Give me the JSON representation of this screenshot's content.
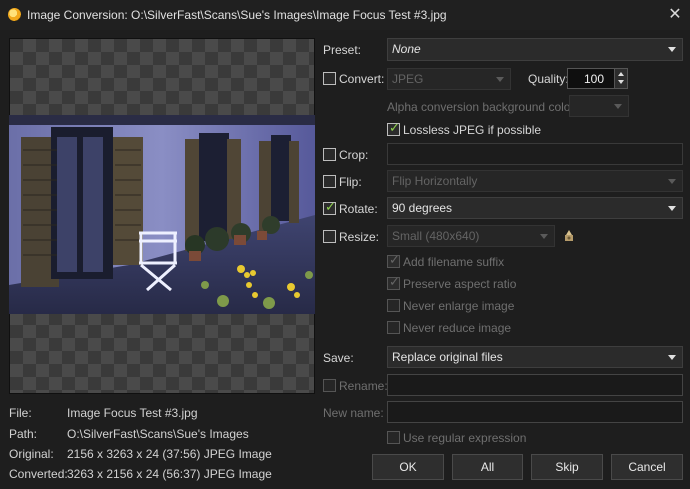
{
  "window": {
    "title": "Image Conversion: O:\\SilverFast\\Scans\\Sue's Images\\Image Focus Test #3.jpg",
    "close_glyph": "✕"
  },
  "options": {
    "preset": {
      "label": "Preset:",
      "value": "None"
    },
    "convert": {
      "label": "Convert:",
      "checked": false,
      "format": "JPEG"
    },
    "quality": {
      "label": "Quality:",
      "value": "100"
    },
    "alpha": {
      "label": "Alpha conversion background color:",
      "value": ""
    },
    "lossless": {
      "label": "Lossless JPEG if possible",
      "checked": true
    },
    "crop": {
      "label": "Crop:",
      "checked": false,
      "value": ""
    },
    "flip": {
      "label": "Flip:",
      "checked": false,
      "value": "Flip Horizontally"
    },
    "rotate": {
      "label": "Rotate:",
      "checked": true,
      "value": "90 degrees"
    },
    "resize": {
      "label": "Resize:",
      "checked": false,
      "value": "Small (480x640)",
      "icon": "magic-wand-icon"
    },
    "add_suffix": {
      "label": "Add filename suffix",
      "checked": true
    },
    "preserve_aspect": {
      "label": "Preserve aspect ratio",
      "checked": true
    },
    "never_enlarge": {
      "label": "Never enlarge image",
      "checked": false
    },
    "never_reduce": {
      "label": "Never reduce image",
      "checked": false
    },
    "save": {
      "label": "Save:",
      "value": "Replace original files"
    },
    "rename": {
      "label": "Rename:",
      "checked": false,
      "value": ""
    },
    "new_name": {
      "label": "New name:",
      "value": ""
    },
    "regex": {
      "label": "Use regular expression",
      "checked": false
    }
  },
  "info": {
    "file": {
      "key": "File:",
      "value": "Image Focus Test #3.jpg"
    },
    "path": {
      "key": "Path:",
      "value": "O:\\SilverFast\\Scans\\Sue's Images"
    },
    "original": {
      "key": "Original:",
      "value": "2156 x 3263 x 24 (37:56) JPEG Image"
    },
    "converted": {
      "key": "Converted:",
      "value": "3263 x 2156 x 24 (56:37) JPEG Image"
    }
  },
  "buttons": {
    "ok": "OK",
    "all": "All",
    "skip": "Skip",
    "cancel": "Cancel"
  },
  "colors": {
    "background": "#1e1e1e",
    "check_accent": "#8fd14f"
  }
}
